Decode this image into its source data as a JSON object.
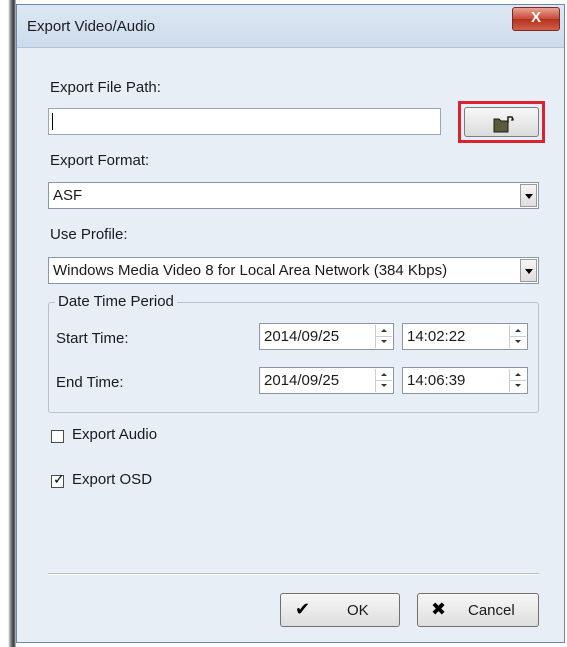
{
  "window": {
    "title": "Export Video/Audio",
    "close_label": "X"
  },
  "export_file_path": {
    "label": "Export File Path:",
    "value": ""
  },
  "export_format": {
    "label": "Export Format:",
    "selected": "ASF"
  },
  "use_profile": {
    "label": "Use Profile:",
    "selected": "Windows Media Video 8 for Local Area Network (384 Kbps)"
  },
  "date_time_period": {
    "legend": "Date Time Period",
    "start": {
      "label": "Start Time:",
      "date": "2014/09/25",
      "time": "14:02:22"
    },
    "end": {
      "label": "End Time:",
      "date": "2014/09/25",
      "time": "14:06:39"
    }
  },
  "options": {
    "export_audio": {
      "label": "Export Audio",
      "checked": false
    },
    "export_osd": {
      "label": "Export OSD",
      "checked": true
    }
  },
  "buttons": {
    "ok": "OK",
    "cancel": "Cancel"
  },
  "icons": {
    "browse": "folder-open-icon",
    "ok": "checkmark-icon",
    "cancel": "x-icon"
  },
  "colors": {
    "highlight": "#d9242f",
    "close_button": "#c74a36",
    "dialog_background": "#e8eef6"
  }
}
